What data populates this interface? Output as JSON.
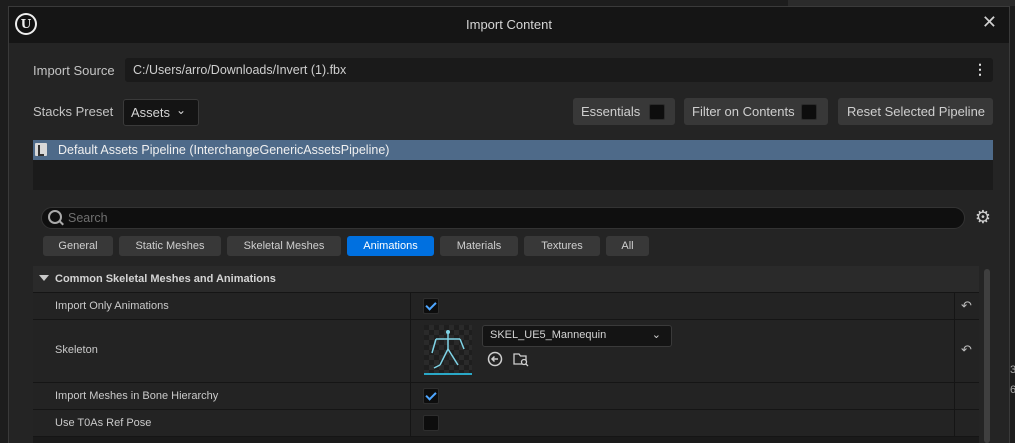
{
  "window": {
    "title": "Import Content",
    "close_glyph": "✕",
    "logo_letter": "U"
  },
  "import_source": {
    "label": "Import Source",
    "value": "C:/Users/arro/Downloads/Invert (1).fbx",
    "more_glyph": "⋮"
  },
  "stacks_preset": {
    "label": "Stacks Preset",
    "selected": "Assets",
    "chevron": "⌄"
  },
  "toolbar": {
    "essentials_label": "Essentials",
    "filter_label": "Filter on Contents",
    "reset_label": "Reset Selected Pipeline"
  },
  "pipeline": {
    "name": "Default Assets Pipeline (InterchangeGenericAssetsPipeline)"
  },
  "search": {
    "placeholder": "Search"
  },
  "tabs": [
    {
      "label": "General",
      "active": false
    },
    {
      "label": "Static Meshes",
      "active": false
    },
    {
      "label": "Skeletal Meshes",
      "active": false
    },
    {
      "label": "Animations",
      "active": true
    },
    {
      "label": "Materials",
      "active": false
    },
    {
      "label": "Textures",
      "active": false
    },
    {
      "label": "All",
      "active": false
    }
  ],
  "details": {
    "category": "Common Skeletal Meshes and Animations",
    "rows": [
      {
        "label": "Import Only Animations",
        "checked": true
      },
      {
        "label": "Skeleton",
        "value": "SKEL_UE5_Mannequin"
      },
      {
        "label": "Import Meshes in Bone Hierarchy",
        "checked": true
      },
      {
        "label": "Use T0As Ref Pose",
        "checked": false
      }
    ],
    "reset_glyph": "↶",
    "combo_chevron": "⌄"
  },
  "edge_digits": [
    "3",
    "6"
  ],
  "colors": {
    "accent": "#0070e0",
    "selection": "#4e6a89",
    "check": "#4ea6ff"
  }
}
